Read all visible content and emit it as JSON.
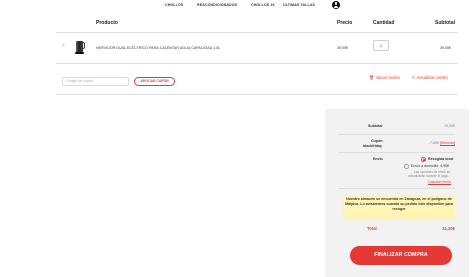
{
  "nav": {
    "items": [
      "CHOLLOS",
      "REACONDICIONADOS",
      "CHOLLOS 1€",
      "ULTIMAS TALLAS"
    ],
    "user_icon": "user-circle-icon"
  },
  "table": {
    "headers": {
      "product": "Producto",
      "price": "Precio",
      "quantity": "Cantidad",
      "subtotal": "Subtotal"
    },
    "rows": [
      {
        "remove": "×",
        "name": "HERVIDOR DUAL ELÉCTRICO PARA CALENTAR AGUA CAPACIDAD 1,5L",
        "price": "39,00€",
        "quantity": "1",
        "subtotal": "39,00€"
      }
    ]
  },
  "coupon": {
    "placeholder": "Código de cupón",
    "apply_label": "APLICAR CUPÓN"
  },
  "cart_actions": {
    "empty_label": "Vaciar carrito",
    "update_label": "Actualizar carrito"
  },
  "totals": {
    "subtotal_label": "Subtotal",
    "subtotal_value": "39,00€",
    "coupon_label_line1": "Cupón:",
    "coupon_label_line2": "blackfriday",
    "coupon_value": "-7,80€",
    "coupon_remove": "[Eliminar]",
    "shipping_label": "Envío",
    "shipping_options": [
      {
        "label": "Recogida local",
        "selected": true
      },
      {
        "label": "Envío a domicilio: 4,95€",
        "selected": false
      }
    ],
    "shipping_note_line1": "Las opciones de envío se",
    "shipping_note_line2": "actualizarán durante el pago.",
    "shipping_calc": "Calcular envío",
    "notice": "Nuestro almacén se encuentra en Zaragoza, en el polígono de Malpica. Lo avisaremos cuando su pedido este disponible para recoger",
    "total_label": "Total",
    "total_value": "31,20€",
    "checkout_label": "FINALIZAR COMPRA"
  },
  "colors": {
    "accent": "#e53935",
    "notice_bg": "#fff4b3",
    "totals_bg": "#f2f2f2"
  }
}
